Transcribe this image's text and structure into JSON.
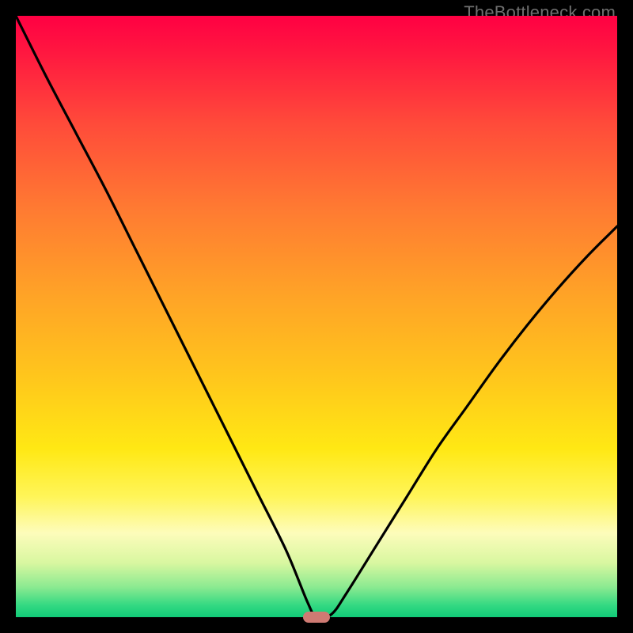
{
  "credit_text": "TheBottleneck.com",
  "colors": {
    "frame": "#000000",
    "gradient_top": "#ff0043",
    "gradient_bottom": "#11cb78",
    "curve": "#000000",
    "marker": "#cf7a73",
    "credit": "#6f6f6f"
  },
  "chart_data": {
    "type": "line",
    "title": "",
    "xlabel": "",
    "ylabel": "",
    "xlim": [
      0,
      100
    ],
    "ylim": [
      0,
      100
    ],
    "gradient_meaning": "background encodes bottleneck severity: top (red) = high, bottom (green) = none",
    "series": [
      {
        "name": "bottleneck-curve",
        "x": [
          0,
          5,
          10,
          15,
          20,
          25,
          30,
          35,
          40,
          45,
          48.5,
          50,
          52.5,
          55,
          60,
          65,
          70,
          75,
          80,
          85,
          90,
          95,
          100
        ],
        "y": [
          100,
          90,
          80.5,
          71,
          61,
          51,
          41,
          31,
          21,
          11,
          2.5,
          0,
          0.5,
          4,
          12,
          20,
          28,
          35,
          42,
          48.5,
          54.5,
          60,
          65
        ]
      }
    ],
    "minimum_marker": {
      "x": 50,
      "y": 0
    },
    "annotations": []
  }
}
